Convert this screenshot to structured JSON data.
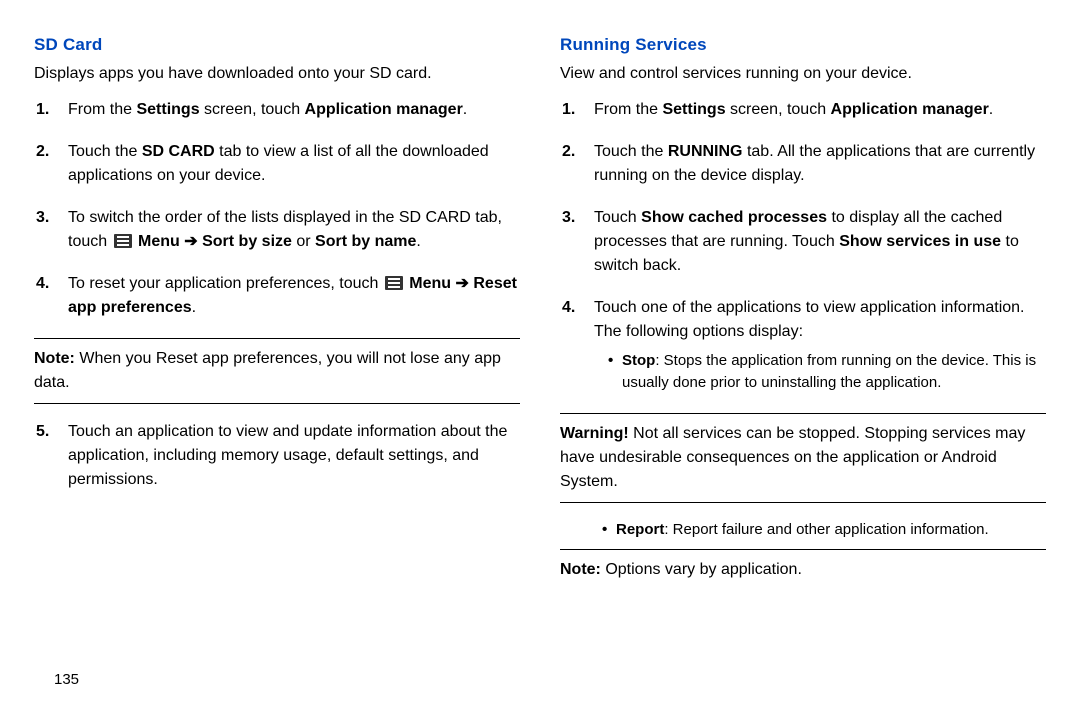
{
  "page_number": "135",
  "left": {
    "heading": "SD Card",
    "intro": "Displays apps you have downloaded onto your SD card.",
    "steps": {
      "s1_a": "From the ",
      "s1_b": "Settings",
      "s1_c": " screen, touch ",
      "s1_d": "Application manager",
      "s1_e": ".",
      "s2_a": "Touch the ",
      "s2_b": "SD CARD",
      "s2_c": " tab to view a list of all the downloaded applications on your device.",
      "s3_a": "To switch the order of the lists displayed in the SD CARD tab, touch ",
      "s3_menu": " Menu ➔ Sort by size",
      "s3_b": " or ",
      "s3_c": "Sort by name",
      "s3_d": ".",
      "s4_a": "To reset your application preferences, touch ",
      "s4_menu": " Menu ➔ Reset app preferences",
      "s4_b": "."
    },
    "note_label": "Note:",
    "note_text": " When you Reset app preferences, you will not lose any app data.",
    "s5": "Touch an application to view and update information about the application, including memory usage, default settings, and permissions."
  },
  "right": {
    "heading": "Running Services",
    "intro": "View and control services running on your device.",
    "steps": {
      "s1_a": "From the ",
      "s1_b": "Settings",
      "s1_c": " screen, touch ",
      "s1_d": "Application manager",
      "s1_e": ".",
      "s2_a": "Touch the ",
      "s2_b": "RUNNING",
      "s2_c": " tab. All the applications that are currently running on the device display.",
      "s3_a": "Touch ",
      "s3_b": "Show cached processes",
      "s3_c": " to display all the cached processes that are running. Touch ",
      "s3_d": "Show services in use",
      "s3_e": " to switch back.",
      "s4": "Touch one of the applications to view application information. The following options display:"
    },
    "bullet_stop_label": "Stop",
    "bullet_stop_text": ": Stops the application from running on the device. This is usually done prior to uninstalling the application.",
    "warning_label": "Warning!",
    "warning_text": " Not all services can be stopped. Stopping services may have undesirable consequences on the application or Android System.",
    "bullet_report_label": "Report",
    "bullet_report_text": ": Report failure and other application information.",
    "note2_label": "Note:",
    "note2_text": " Options vary by application."
  }
}
